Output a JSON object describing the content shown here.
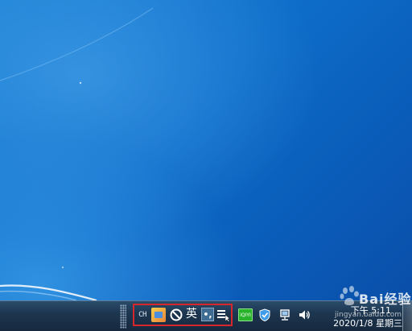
{
  "taskbar": {
    "language_bar": {
      "language_code": "CH",
      "input_mode": "英",
      "punctuation_mode": "•,"
    },
    "tray_icons": [
      "ime-logo-icon",
      "no-symbol-icon",
      "soft-keyboard-icon",
      "green-app-icon",
      "shield-icon",
      "network-icon",
      "volume-icon"
    ],
    "green_app_label": "iQIYI",
    "clock": {
      "time": "下午 5:11",
      "date": "2020/1/8 星期三"
    }
  },
  "watermark": {
    "brand": "Bai经验",
    "url": "jingyan.baidu.com"
  },
  "colors": {
    "desktop_blue": "#0d6cc8",
    "taskbar": "#1d3650",
    "highlight_box": "#d7262c",
    "green_app": "#28b32a"
  }
}
